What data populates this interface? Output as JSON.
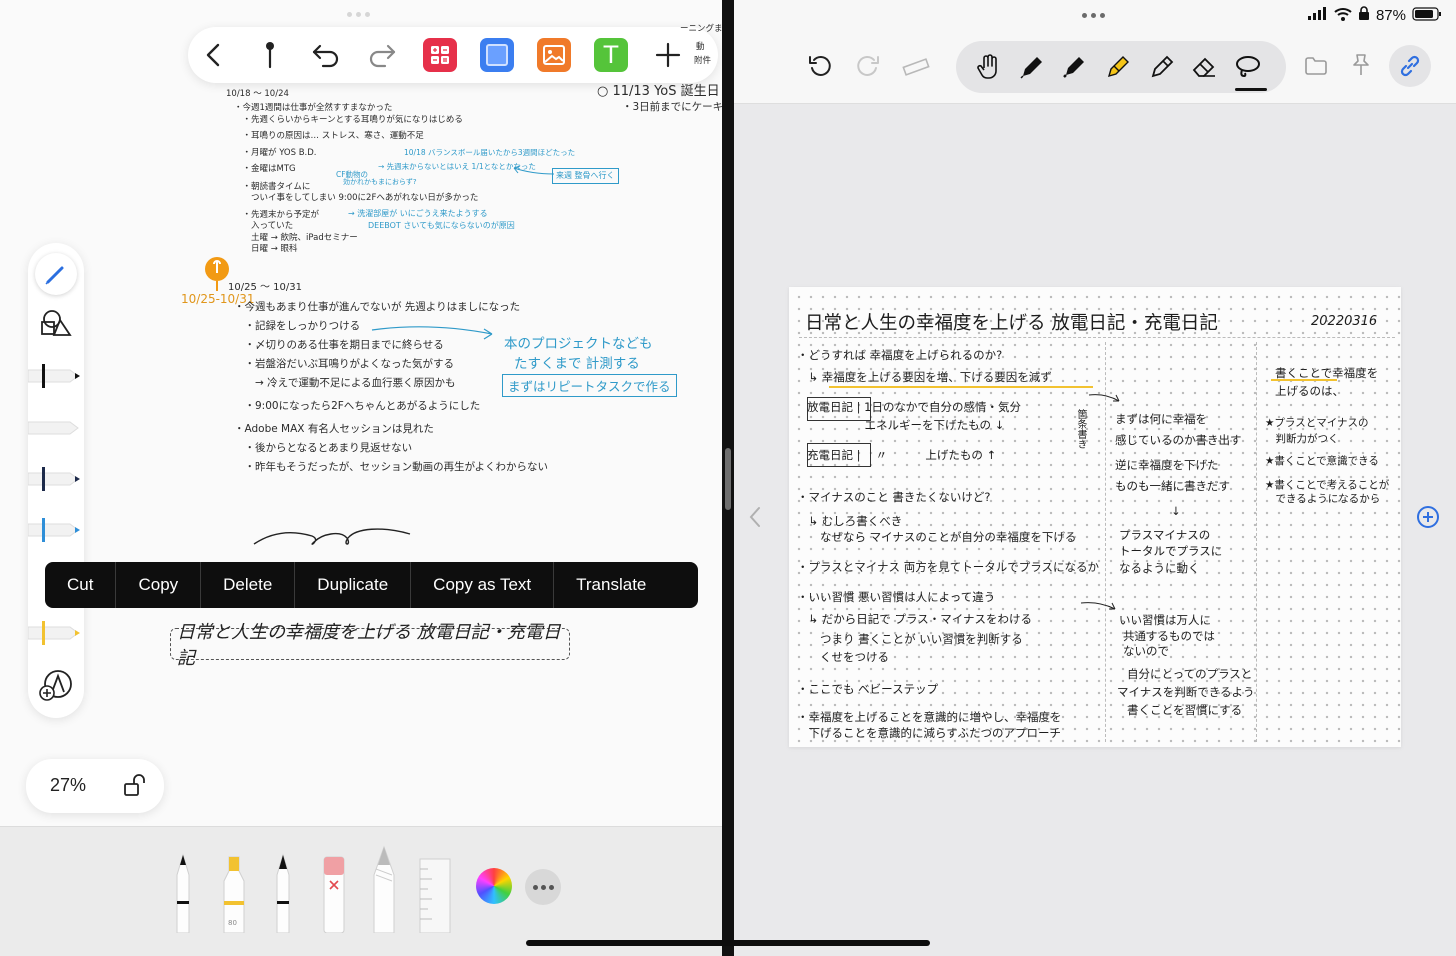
{
  "left": {
    "toolbar": {
      "back_icon": "chevron-left-icon",
      "pin_icon": "pin-icon",
      "undo_icon": "undo-icon",
      "redo_icon": "redo-icon",
      "apps": [
        {
          "name": "calculator-app-icon",
          "color": "#e6304a"
        },
        {
          "name": "square-app-icon",
          "color": "#3b7ef0"
        },
        {
          "name": "image-app-icon",
          "color": "#f07a2a"
        },
        {
          "name": "text-app-icon",
          "color": "#55c43a",
          "glyph": "T"
        }
      ],
      "add_icon": "plus-icon"
    },
    "notes": {
      "header_right_1": "ーニングま",
      "header_right_2": "動",
      "header_right_3": "附件",
      "header_right_4": "○ 11/13 YoS 誕生日",
      "header_right_5": "・3日前までにケーキ",
      "week1_title": "10/18 〜 10/24",
      "week1_lines": [
        "・今週1週間は仕事が全然すすまなかった",
        "　・先週くらいからキーンとする耳鳴りが気になりはじめる",
        "　・耳鳴りの原因は… ストレス、寒さ、運動不足",
        "　・月曜が YOS B.D.",
        "　・金曜はMTG",
        "　・朝読書タイムに",
        "　　ついイ事をしてしまい 9:00に2Fへあがれない日が多かった",
        "　・先週末から予定が",
        "　　入っていた",
        "　　土曜 → 飲院、iPadセミナー",
        "　　日曜 → 眼科"
      ],
      "week1_blue_1": "10/18 バランスボール届いたから3週間ほどたった",
      "week1_blue_2": "→ 先週末からないとはいえ 1/1となとかなった",
      "week1_blue_3": "CF動物の",
      "week1_blue_4": "効かれかもまにおらず?",
      "week1_blue_5": "→ 洗濯部屋が いにごうえ来たようする",
      "week1_blue_6": "DEEBOT さいても気にならないのが原因",
      "week1_box": "来週 整骨へ行く",
      "week2_pin_label": "10/25-10/31",
      "week2_title": "10/25 〜 10/31",
      "week2_lines": [
        "・今週もあまり仕事が進んでないが 先週よりはましになった",
        "　・記録をしっかりつける",
        "　・〆切りのある仕事を期日までに終らせる",
        "　・岩盤浴だいぶ耳鳴りがよくなった気がする",
        "　　→ 冷えで運動不足による血行悪く原因かも",
        "　・9:00になったら2Fへちゃんとあがるようにした",
        "・Adobe MAX 有名人セッションは見れた",
        "　・後からとなるとあまり見返せない",
        "　・昨年もそうだったが、セッション動画の再生がよくわからない"
      ],
      "week2_blue_1": "本のプロジェクトなども",
      "week2_blue_2": "たすくまで 計測する",
      "week2_blue_3": "まずはリピートタスクで作る"
    },
    "sidebar": {
      "pen_icon": "pen-icon",
      "shapes_icon": "shapes-icon",
      "add_tool_icon": "add-tool-icon"
    },
    "context_menu": [
      "Cut",
      "Copy",
      "Delete",
      "Duplicate",
      "Copy as Text",
      "Translate"
    ],
    "selected_text": "日常と人生の幸福度を上げる 放電日記・充電日記",
    "zoom": {
      "value": "27%",
      "lock_icon": "unlock-icon"
    },
    "tray": {
      "tools": [
        "pen-tool-icon",
        "highlighter-tool-icon",
        "fountain-pen-tool-icon",
        "eraser-tool-icon",
        "pencil-tool-icon",
        "ruler-tool-icon"
      ],
      "highlighter_label": "80",
      "color_icon": "color-picker-icon",
      "more_icon": "more-icon"
    }
  },
  "right": {
    "status": {
      "battery": "87%",
      "signal_icon": "signal-icon",
      "wifi_icon": "wifi-icon",
      "lock_icon": "orientation-lock-icon",
      "battery_icon": "battery-icon"
    },
    "toolbar": {
      "undo_icon": "undo-icon",
      "redo_icon": "redo-icon",
      "ruler_icon": "ruler-icon",
      "tools": [
        "hand-icon",
        "pen-icon",
        "marker-icon",
        "highlighter-icon",
        "pencil-icon",
        "eraser-icon",
        "lasso-icon"
      ],
      "folder_icon": "folder-icon",
      "pin_icon": "pin-icon",
      "link_icon": "link-icon"
    },
    "page": {
      "title": "日常と人生の幸福度を上げる 放電日記・充電日記",
      "date": "20220316",
      "col1": [
        "・どうすれば 幸福度を上げられるのか?",
        "　↳ 幸福度を上げる要因を増、下げる要因を減ず",
        "放電日記 | 1日のなかで自分の感情・気分",
        "　　　　　エネルギーを下げたもの ↓",
        "充電日記 |　 〃　　　 上げたもの ↑",
        "・マイナスのこと 書きたくないけど?",
        "　↳ むしろ書くべき",
        "　　なぜなら マイナスのことが自分の幸福度を下げる",
        "・プラスとマイナス 両方を見てトータルでプラスになるか",
        "・いい習慣 悪い習慣は人によって違う",
        "　↳ だから日記で プラス・マイナスをわける",
        "　　つまり 書くことが いい習慣を判断する",
        "　　くせをつける",
        "・ここでも ベビーステップ",
        "・幸福度を上げることを意識的に増やし、幸福度を",
        "　下げることを意識的に減らすふたつのアプローチ"
      ],
      "col1_side": "箇条書き",
      "col2": [
        "まずは何に幸福を",
        "感じているのか書き出す",
        "逆に幸福度を下げた",
        "ものも一緒に書きだす",
        "↓",
        "プラスマイナスの",
        "トータルでプラスに",
        "なるように動く",
        "いい習慣は万人に",
        "共通するものでは",
        "ないので",
        "自分にとってのプラスと",
        "マイナスを判断できるよう",
        "書くことを習慣にする"
      ],
      "col3": [
        "書くことで幸福度を",
        "上げるのは、",
        "★プラスとマイナスの",
        "　判断力がつく",
        "★書くことで意識できる",
        "★書くことで考えることが",
        "　できるようになるから"
      ],
      "prev_icon": "chevron-left-icon",
      "add_page_icon": "add-circle-icon"
    }
  }
}
